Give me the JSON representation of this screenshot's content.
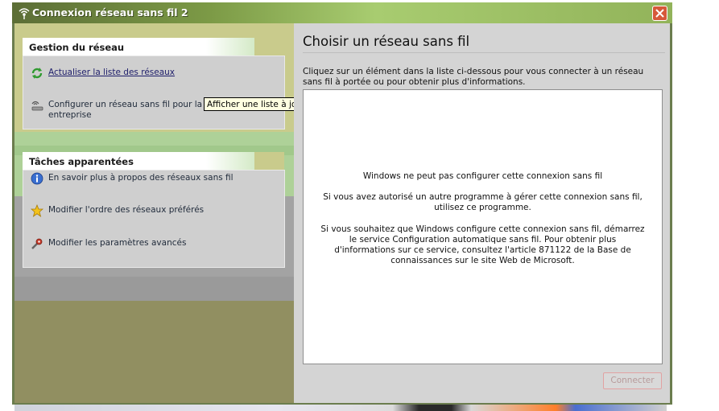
{
  "window": {
    "title": "Connexion réseau sans fil 2",
    "accent_color": "#7c9a46",
    "close_color": "#d6593a"
  },
  "left_pane": {
    "network_group": {
      "header": "Gestion du réseau",
      "items": [
        {
          "label": "Actualiser la liste des réseaux",
          "icon": "refresh-icon"
        },
        {
          "label_line1": "Configurer un réseau sans fil pour la ma",
          "label_line2": "entreprise",
          "icon": "wireless-setup-icon"
        }
      ]
    },
    "related_group": {
      "header": "Tâches apparentées",
      "items": [
        {
          "label": "En savoir plus à propos des réseaux sans fil",
          "icon": "info-icon"
        },
        {
          "label": "Modifier l'ordre des réseaux préférés",
          "icon": "star-icon"
        },
        {
          "label": "Modifier les paramètres avancés",
          "icon": "settings-icon"
        }
      ]
    },
    "tooltip": "Afficher une liste à jour"
  },
  "right_pane": {
    "title": "Choisir un réseau sans fil",
    "instruction": "Cliquez sur un élément dans la liste ci-dessous pour vous connecter à un réseau sans fil à portée ou pour obtenir plus d'informations.",
    "list_messages": {
      "line1": "Windows ne peut pas configurer cette connexion sans fil",
      "line2": "Si vous avez autorisé un autre programme à gérer cette connexion sans fil, utilisez ce programme.",
      "line3": "Si vous souhaitez que Windows configure cette connexion sans fil, démarrez le service Configuration automatique sans fil. Pour obtenir plus d'informations sur ce service, consultez l'article 871122 de la Base de connaissances sur le site Web de Microsoft."
    },
    "connect_button": "Connecter"
  }
}
